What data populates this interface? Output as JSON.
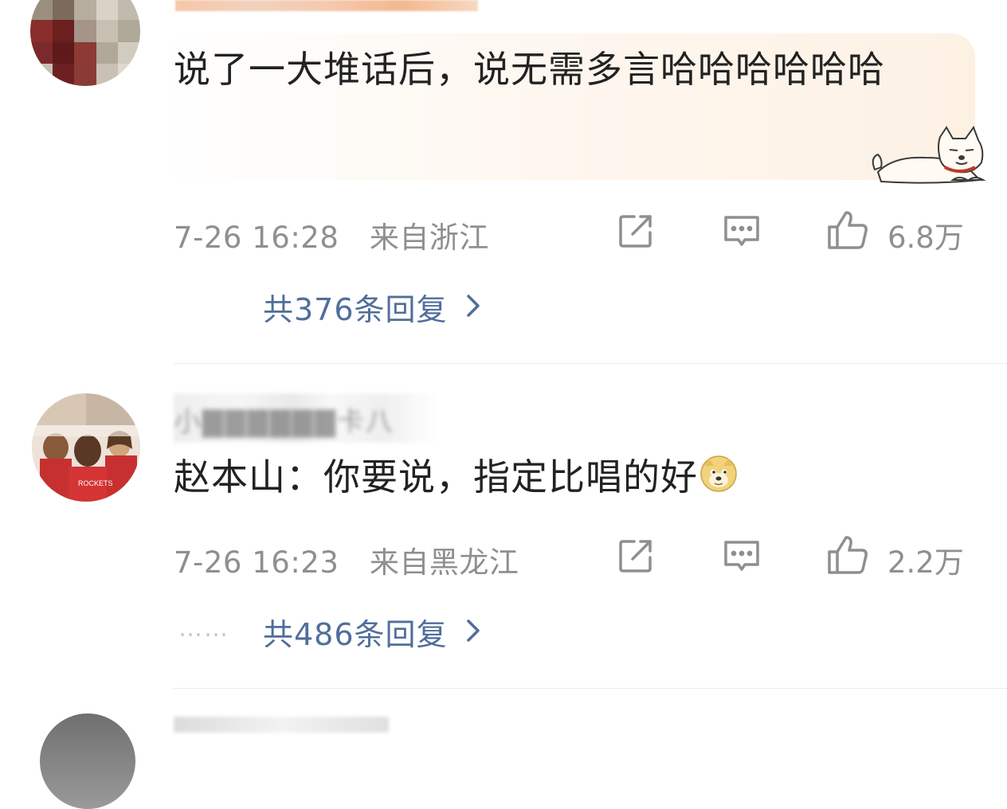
{
  "comments": [
    {
      "text": "说了一大堆话后，说无需多言哈哈哈哈哈哈",
      "time": "7-26 16:28",
      "location": "来自浙江",
      "likes": "6.8万",
      "replies": "共376条回复",
      "sticker": "shiba-dog-sticker"
    },
    {
      "username": "小▇▇▇▇▇▇卡八",
      "text": "赵本山：你要说，指定比唱的好",
      "emoji": "doge-emoji",
      "time": "7-26 16:23",
      "location": "来自黑龙江",
      "likes": "2.2万",
      "replies": "共486条回复",
      "reply_dots": "……"
    }
  ],
  "icons": {
    "share": "share-edit-icon",
    "comment": "comment-bubble-icon",
    "like": "thumbs-up-icon",
    "chevron": "chevron-right-icon"
  },
  "colors": {
    "link": "#506e9b",
    "meta": "#8f8f8f",
    "highlight_bg": "#fdf5ec"
  }
}
